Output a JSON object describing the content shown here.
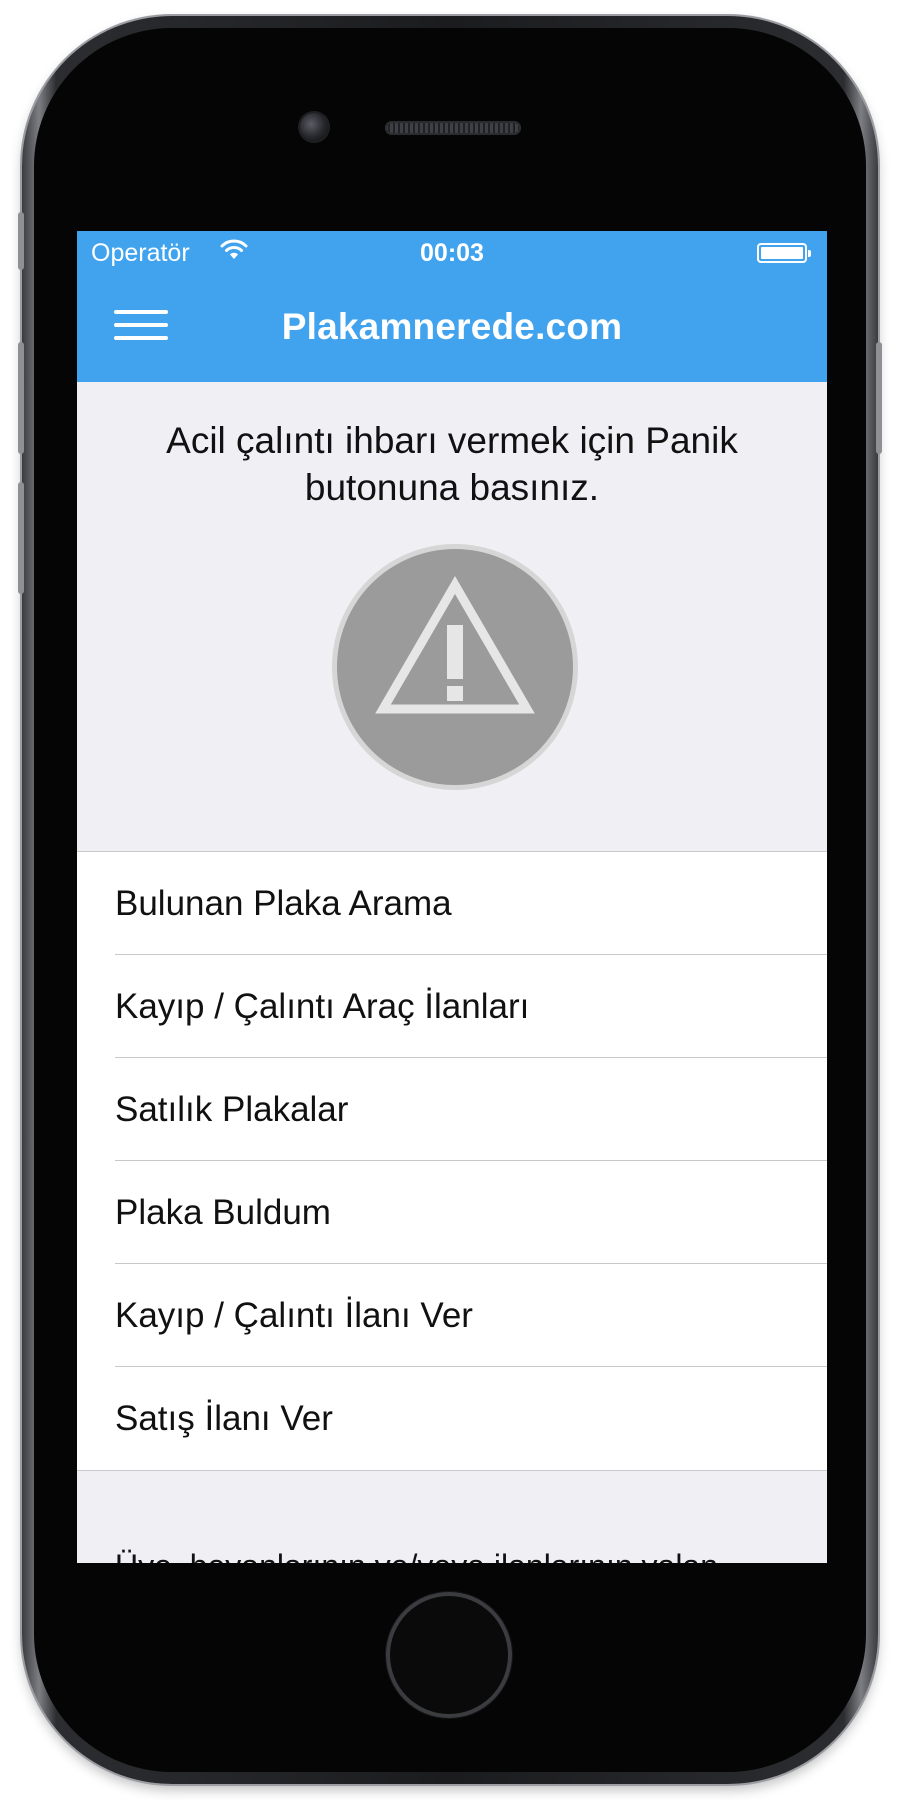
{
  "status_bar": {
    "carrier": "Operatör",
    "time": "00:03",
    "wifi_icon": "wifi-icon",
    "battery_icon": "battery-icon"
  },
  "nav": {
    "title": "Plakamnerede.com",
    "menu_icon": "hamburger-menu-icon"
  },
  "panic": {
    "instruction": "Acil çalıntı ihbarı vermek için Panik butonuna basınız.",
    "icon": "warning-triangle-icon"
  },
  "menu": {
    "items": [
      {
        "label": "Bulunan Plaka Arama"
      },
      {
        "label": "Kayıp / Çalıntı Araç İlanları"
      },
      {
        "label": "Satılık Plakalar"
      },
      {
        "label": "Plaka Buldum"
      },
      {
        "label": "Kayıp / Çalıntı İlanı Ver"
      },
      {
        "label": "Satış İlanı Ver"
      }
    ]
  },
  "footer": {
    "disclaimer": "Üye, beyanlarının ve/veya ilanlarının yalan"
  },
  "colors": {
    "accent": "#41a3ee",
    "screen_background": "#efeff4",
    "panic_button": "#9b9b9b"
  }
}
